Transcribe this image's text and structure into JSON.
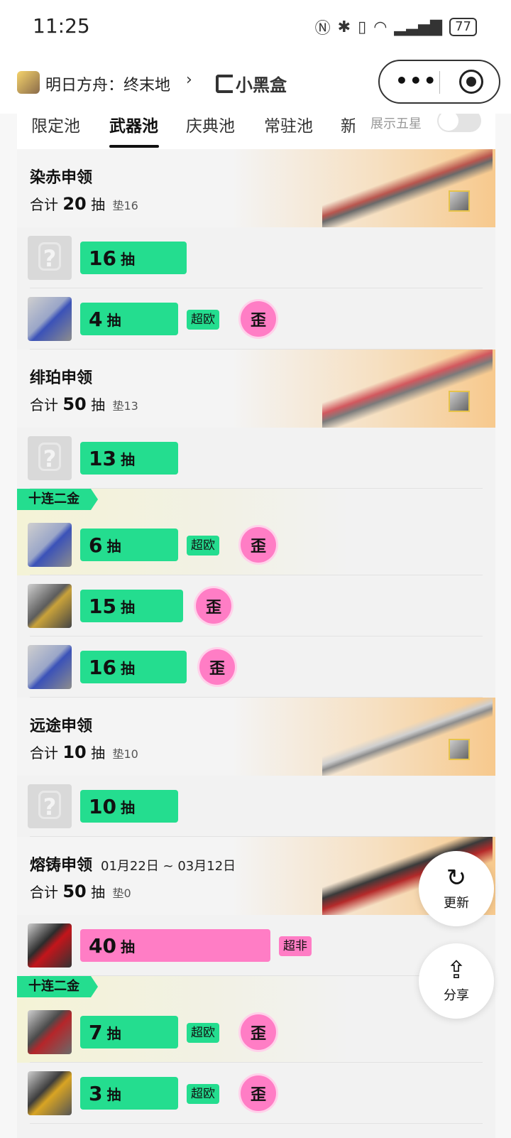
{
  "status_bar": {
    "time": "11:25",
    "battery": "77"
  },
  "miniprogram": {
    "title": "明日方舟：终末地",
    "chevron": "›",
    "brand": "小黑盒",
    "menu_dots": "•••"
  },
  "tabs": {
    "items": [
      "限定池",
      "武器池",
      "庆典池",
      "常驻池",
      "新"
    ],
    "active_index": 1
  },
  "toggle": {
    "label": "展示五星",
    "on": false
  },
  "labels": {
    "total_prefix": "合计",
    "pull_unit": "抽",
    "pity_prefix": "垫",
    "ten_pull_double": "十连二金",
    "lucky": "超欧",
    "unlucky": "超非",
    "wai": "歪"
  },
  "sections": [
    {
      "name": "染赤申领",
      "total": "20",
      "pity": "16",
      "daterange": "",
      "rows": [
        {
          "pulls": "16",
          "thumb": "unknown",
          "lucky": "",
          "wai": "",
          "golden": false
        },
        {
          "pulls": "4",
          "thumb": "weapon-blue",
          "lucky": "超欧",
          "wai": "歪",
          "golden": false
        }
      ]
    },
    {
      "name": "绯珀申领",
      "total": "50",
      "pity": "13",
      "daterange": "",
      "rows": [
        {
          "pulls": "13",
          "thumb": "unknown",
          "lucky": "",
          "wai": "",
          "golden": false
        },
        {
          "pulls": "6",
          "thumb": "weapon-blue",
          "lucky": "超欧",
          "wai": "歪",
          "golden": true
        },
        {
          "pulls": "15",
          "thumb": "weapon-gold",
          "lucky": "",
          "wai": "歪",
          "golden": false
        },
        {
          "pulls": "16",
          "thumb": "weapon-blue",
          "lucky": "",
          "wai": "歪",
          "golden": false
        }
      ]
    },
    {
      "name": "远途申领",
      "total": "10",
      "pity": "10",
      "daterange": "",
      "rows": [
        {
          "pulls": "10",
          "thumb": "unknown",
          "lucky": "",
          "wai": "",
          "golden": false
        }
      ]
    },
    {
      "name": "熔铸申领",
      "total": "50",
      "pity": "0",
      "daterange": "01月22日 ~ 03月12日",
      "rows": [
        {
          "pulls": "40",
          "thumb": "weapon-red",
          "lucky": "超非",
          "wai": "",
          "golden": false
        },
        {
          "pulls": "7",
          "thumb": "gun-red",
          "lucky": "超欧",
          "wai": "歪",
          "golden": true
        },
        {
          "pulls": "3",
          "thumb": "gun-gold",
          "lucky": "超欧",
          "wai": "歪",
          "golden": false
        }
      ]
    }
  ],
  "fabs": {
    "refresh": "更新",
    "share": "分享"
  },
  "icons": {
    "refresh": "refresh-icon",
    "share": "share-icon",
    "target": "target-icon",
    "ellipsis": "more-icon",
    "brand": "xiaoheihe-logo-icon"
  },
  "colors": {
    "green": "#24dd8f",
    "pink": "#ff7dc5",
    "gold_border": "#e6c34a"
  }
}
